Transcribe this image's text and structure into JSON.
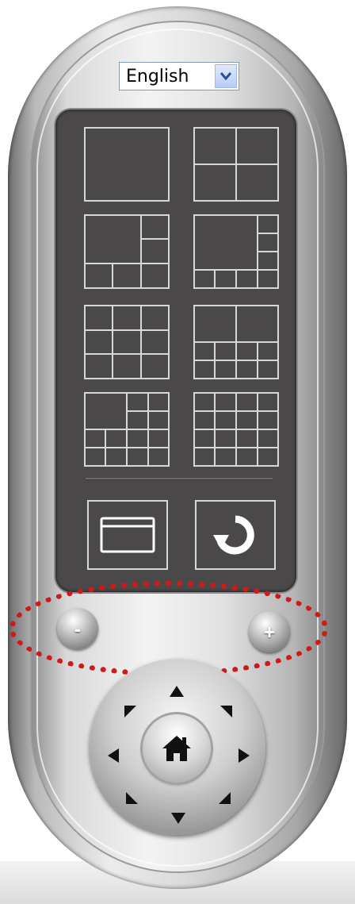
{
  "language_selector": {
    "value": "English"
  },
  "layout_buttons": [
    {
      "name": "layout-1-button",
      "icon": "layout-single-icon"
    },
    {
      "name": "layout-4-button",
      "icon": "layout-quad-icon"
    },
    {
      "name": "layout-6-button",
      "icon": "layout-six-icon"
    },
    {
      "name": "layout-8-button",
      "icon": "layout-eight-icon"
    },
    {
      "name": "layout-9-button",
      "icon": "layout-nine-icon"
    },
    {
      "name": "layout-10-button",
      "icon": "layout-ten-icon"
    },
    {
      "name": "layout-13-button",
      "icon": "layout-thirteen-icon"
    },
    {
      "name": "layout-16-button",
      "icon": "layout-sixteen-icon"
    }
  ],
  "action_buttons": [
    {
      "name": "full-screen-button",
      "icon": "window-icon"
    },
    {
      "name": "rotate-button",
      "icon": "rotate-icon"
    }
  ],
  "zoom": {
    "out_label": "-",
    "in_label": "+"
  },
  "ptz": {
    "center_icon": "home-icon",
    "directions": [
      "up",
      "up-right",
      "right",
      "down-right",
      "down",
      "down-left",
      "left",
      "up-left"
    ]
  },
  "colors": {
    "panel": "#4a4849",
    "highlight_dots": "#d01a1a"
  }
}
